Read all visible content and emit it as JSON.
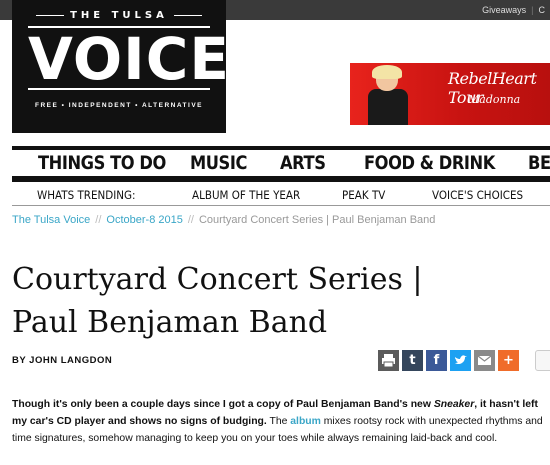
{
  "topbar": {
    "links": [
      "Giveaways",
      "C"
    ]
  },
  "logo": {
    "top": "THE TULSA",
    "main": "VOICE",
    "tagline": "FREE • INDEPENDENT • ALTERNATIVE"
  },
  "ad": {
    "title": "RebelHeart Tour",
    "subtitle": "Madonna"
  },
  "main_nav": [
    "THINGS TO DO",
    "MUSIC",
    "ARTS",
    "FOOD & DRINK",
    "BES"
  ],
  "trending_nav": [
    "WHATS TRENDING:",
    "ALBUM OF THE YEAR",
    "PEAK TV",
    "VOICE'S CHOICES"
  ],
  "breadcrumb": {
    "site": "The Tulsa Voice",
    "date": "October-8 2015",
    "current": "Courtyard Concert Series | Paul Benjaman Band",
    "separator": "//"
  },
  "article": {
    "title_line1": "Courtyard Concert Series |",
    "title_line2": "Paul Benjaman Band",
    "byline": "BY JOHN LANGDON",
    "lead_1": "Though it's only been a couple days since I got a copy of Paul Benjaman Band's new ",
    "lead_em": "Sneaker",
    "lead_2": ", it hasn't left my car's CD player and shows no signs of budging.",
    "body_1": " The ",
    "album_link": "album",
    "body_2": " mixes rootsy rock with unexpected rhythms and time signatures, somehow managing to keep you on your toes while always remaining laid-back and cool."
  },
  "share": {
    "print": "print-icon",
    "tumblr": "t",
    "facebook": "f",
    "twitter": "twitter-icon",
    "email": "email-icon",
    "plus": "+"
  },
  "colors": {
    "accent_link": "#3aa6c7",
    "topbar": "#3a3a3a",
    "ad_red": "#d01a16"
  }
}
